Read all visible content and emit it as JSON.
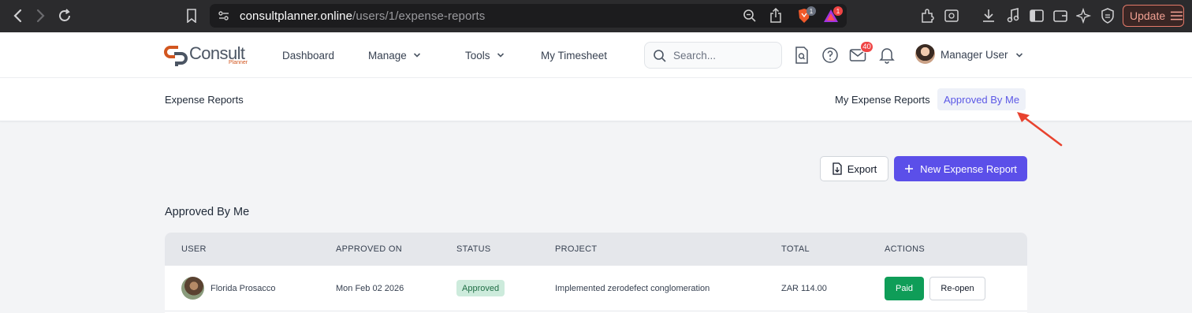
{
  "browser": {
    "url_domain": "consultplanner.online",
    "url_path": "/users/1/expense-reports",
    "brave_badge": "1",
    "ext_badge": "1",
    "update_label": "Update"
  },
  "app": {
    "logo_text": "Consult",
    "logo_sub": "Planner",
    "nav": {
      "dashboard": "Dashboard",
      "manage": "Manage",
      "tools": "Tools",
      "timesheet": "My Timesheet"
    },
    "search_placeholder": "Search...",
    "mail_count": "40",
    "user_name": "Manager User"
  },
  "subheader": {
    "breadcrumb": "Expense Reports",
    "tabs": {
      "my_reports": "My Expense Reports",
      "approved_by_me": "Approved By Me"
    }
  },
  "actions": {
    "export": "Export",
    "new_report": "New Expense Report"
  },
  "section_title": "Approved By Me",
  "table": {
    "headers": {
      "user": "USER",
      "approved_on": "APPROVED ON",
      "status": "STATUS",
      "project": "PROJECT",
      "total": "TOTAL",
      "actions": "ACTIONS"
    },
    "rows": [
      {
        "user": "Florida Prosacco",
        "approved_on": "Mon Feb 02 2026",
        "status": "Approved",
        "project": "Implemented zerodefect conglomeration",
        "total": "ZAR 114.00",
        "paid_label": "Paid",
        "reopen_label": "Re-open"
      }
    ]
  },
  "colors": {
    "accent": "#5b4fe9",
    "paid_green": "#0f9d58",
    "annotation_red": "#e8432f"
  }
}
